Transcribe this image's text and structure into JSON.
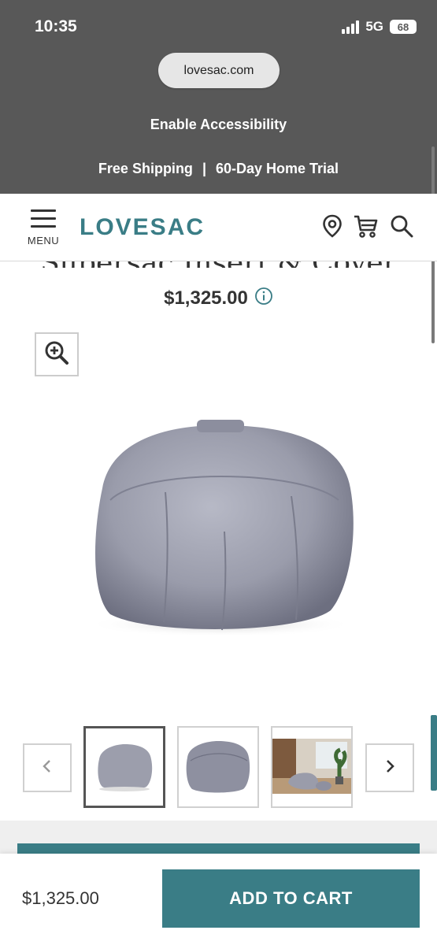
{
  "status_bar": {
    "time": "10:35",
    "network": "5G",
    "battery": "68"
  },
  "browser": {
    "url": "lovesac.com"
  },
  "banner": {
    "accessibility": "Enable Accessibility",
    "shipping": "Free Shipping",
    "separator": "|",
    "trial": "60-Day Home Trial"
  },
  "header": {
    "menu_label": "MENU",
    "logo": "LOVESAC",
    "icons": [
      "location-pin-icon",
      "cart-icon",
      "search-icon"
    ]
  },
  "product": {
    "title": "Supersac Insert & Cover",
    "price": "$1,325.00",
    "info_icon": "info-icon",
    "zoom_icon": "zoom-in-icon"
  },
  "gallery": {
    "prev_icon": "chevron-left-icon",
    "next_icon": "chevron-right-icon",
    "active_index": 0
  },
  "sticky": {
    "price": "$1,325.00",
    "add_to_cart": "ADD TO CART"
  },
  "colors": {
    "teal": "#3a7d86",
    "chrome_gray": "#585858",
    "text_dark": "#333333"
  }
}
